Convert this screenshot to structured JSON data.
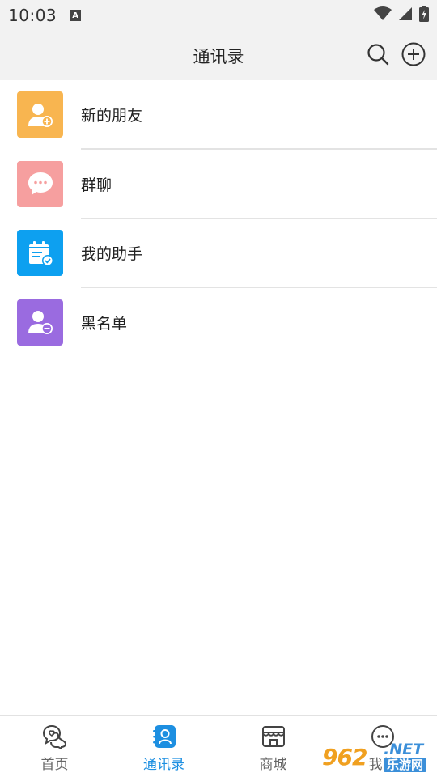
{
  "status_bar": {
    "time": "10:03",
    "notification_glyph": "A"
  },
  "header": {
    "title": "通讯录",
    "search_icon": "search-icon",
    "add_icon": "plus-circle-icon"
  },
  "list": {
    "items": [
      {
        "label": "新的朋友",
        "icon": "add-user-icon",
        "color": "#f8b550"
      },
      {
        "label": "群聊",
        "icon": "chat-bubble-icon",
        "color": "#f69f9f"
      },
      {
        "label": "我的助手",
        "icon": "calendar-check-icon",
        "color": "#0da0f0"
      },
      {
        "label": "黑名单",
        "icon": "remove-user-icon",
        "color": "#9a6be0"
      }
    ]
  },
  "bottom_nav": {
    "items": [
      {
        "label": "首页",
        "icon": "home-chat-icon",
        "active": false
      },
      {
        "label": "通讯录",
        "icon": "contacts-icon",
        "active": true
      },
      {
        "label": "商城",
        "icon": "store-icon",
        "active": false
      },
      {
        "label": "我的",
        "icon": "profile-icon",
        "active": false
      }
    ]
  },
  "watermark": {
    "logo": "962",
    "net": ".NET",
    "sub": "乐游网"
  },
  "colors": {
    "accent": "#1d8fe1",
    "header_bg": "#f2f2f2"
  }
}
